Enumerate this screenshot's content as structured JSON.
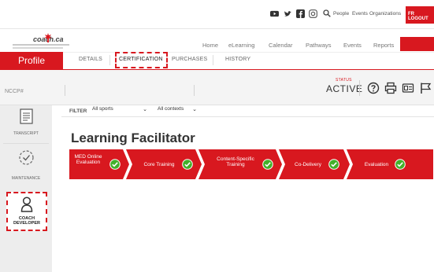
{
  "topbar": {
    "social_icons": [
      "youtube-icon",
      "twitter-icon",
      "facebook-icon",
      "instagram-icon"
    ],
    "links": [
      "People",
      "Events",
      "Organizations"
    ],
    "language": "FR LOGOUT"
  },
  "logo": {
    "text": "coach.ca"
  },
  "nav": {
    "links": [
      "Home",
      "eLearning",
      "Calendar",
      "Pathways",
      "Events",
      "Reports"
    ]
  },
  "profile": {
    "title": "Profile",
    "tabs": [
      "DETAILS",
      "CERTIFICATION",
      "PURCHASES",
      "HISTORY"
    ],
    "active_tab": "CERTIFICATION"
  },
  "info": {
    "nccp_label": "NCCP#",
    "status_label": "STATUS",
    "status_value": "ACTIVE",
    "tools": [
      "help-icon",
      "print-icon",
      "id-card-icon",
      "flag-icon"
    ]
  },
  "sidebar": {
    "items": [
      {
        "label": "TRANSCRIPT",
        "icon": "transcript-icon"
      },
      {
        "label": "MAINTENANCE",
        "icon": "maintenance-icon"
      },
      {
        "label": "COACH DEVELOPER",
        "icon": "coach-developer-icon"
      }
    ]
  },
  "filter": {
    "label": "FILTER",
    "sport_value": "All sports",
    "context_value": "All contexts"
  },
  "page": {
    "title": "Learning Facilitator"
  },
  "steps": [
    {
      "label": "MED Online Evaluation",
      "status": "complete"
    },
    {
      "label": "Core Training",
      "status": "complete"
    },
    {
      "label": "Content-Specific Training",
      "status": "complete"
    },
    {
      "label": "Co-Delivery",
      "status": "complete"
    },
    {
      "label": "Evaluation",
      "status": "complete"
    }
  ],
  "colors": {
    "brand_red": "#d8181f",
    "check_green": "#43b02a"
  }
}
